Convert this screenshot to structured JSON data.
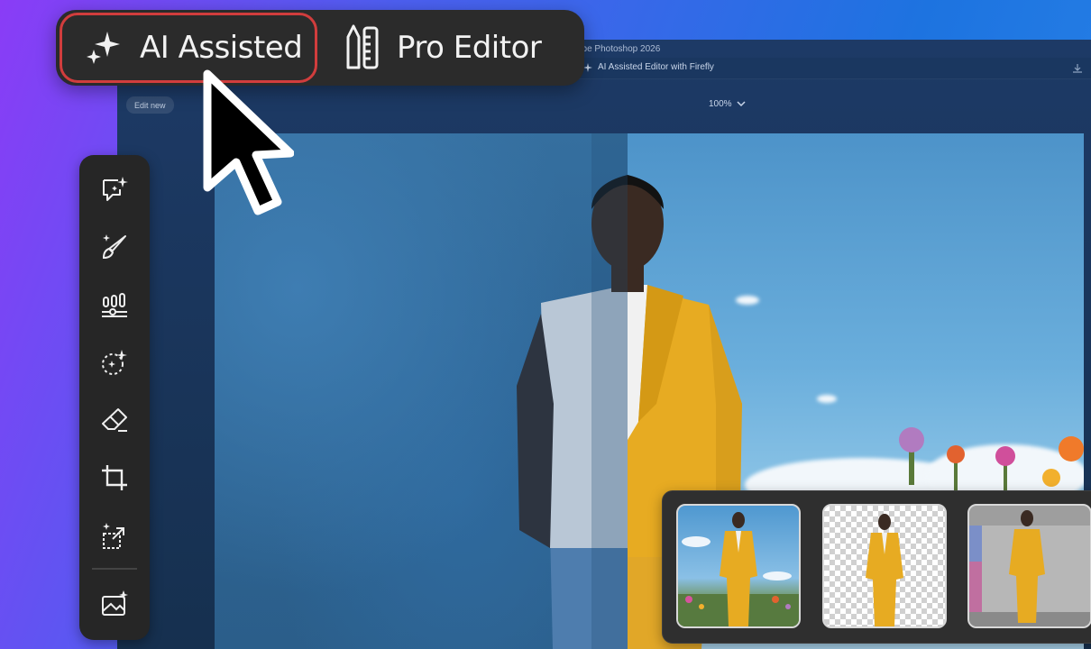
{
  "window": {
    "app_title": "Adobe Photoshop 2026",
    "document_title": "AI Assisted Editor with Firefly"
  },
  "toolbar": {
    "edit_new_label": "Edit new",
    "zoom_value": "100%"
  },
  "mode_switch": {
    "ai_label": "AI Assisted",
    "pro_label": "Pro Editor",
    "selected": "AI Assisted",
    "selected_outline_color": "#d13d3d"
  },
  "tool_rail": {
    "tools": [
      "generative-chat-icon",
      "brush-sparkle-icon",
      "adjustments-icon",
      "selection-sparkle-icon",
      "eraser-icon",
      "crop-icon",
      "expand-sparkle-icon",
      "image-generate-icon"
    ]
  },
  "variations": {
    "items": [
      "yellow suit in flower field",
      "yellow suit on transparent background",
      "yellow suit in concrete room"
    ]
  },
  "colors": {
    "accent_purple": "#8a3cf6",
    "accent_blue": "#1d73e0",
    "panel_dark": "#2b2b2b"
  }
}
